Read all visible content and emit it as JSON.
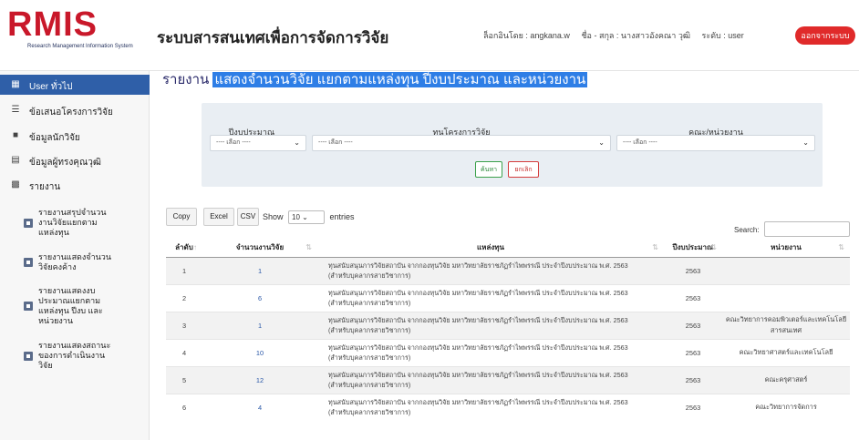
{
  "header": {
    "logo_text": "RMIS",
    "logo_subtitle": "Research Management Information System",
    "app_title": "ระบบสารสนเทศเพื่อการจัดการวิจัย",
    "login_label": "ล็อกอินโดย : angkana.w",
    "name_label": "ชื่อ - สกุล : นางสาวอังคณา วุฒิ",
    "level_label": "ระดับ : user",
    "logout_label": "ออกจากระบบ"
  },
  "sidebar": {
    "items": [
      {
        "label": "User ทั่วไป",
        "icon": "grid-icon"
      },
      {
        "label": "ข้อเสนอโครงการวิจัย",
        "icon": "layers-icon"
      },
      {
        "label": "ข้อมูลนักวิจัย",
        "icon": "folder-icon"
      },
      {
        "label": "ข้อมูลผู้ทรงคุณวุฒิ",
        "icon": "list-icon"
      },
      {
        "label": "รายงาน",
        "icon": "bar-chart-icon"
      }
    ],
    "sub_items": [
      {
        "lines": [
          "รายงานสรุปจำนวน",
          "งานวิจัยแยกตาม",
          "แหล่งทุน"
        ]
      },
      {
        "lines": [
          "รายงานแสดงจำนวน",
          "วิจัยคงค้าง"
        ]
      },
      {
        "lines": [
          "รายงานแสดงงบ",
          "ประมาณแยกตาม",
          "แหล่งทุน ปีงบ และ",
          "หน่วยงาน"
        ]
      },
      {
        "lines": [
          "รายงานแสดงสถานะ",
          "ของการดำเนินงาน",
          "วิจัย"
        ]
      }
    ]
  },
  "main": {
    "heading_prefix": "รายงาน",
    "heading_highlight": "แสดงจำนวนวิจัย แยกตามแหล่งทุน ปีงบประมาณ และหน่วยงาน"
  },
  "filters": {
    "year_label": "ปีงบประมาณ",
    "fund_label": "ทุนโครงการวิจัย",
    "faculty_label": "คณะ/หน่วยงาน",
    "select_placeholder": "---- เลือก ----",
    "search_button": "ค้นหา",
    "cancel_button": "ยกเลิก"
  },
  "table_controls": {
    "copy": "Copy",
    "excel": "Excel",
    "csv": "CSV",
    "show": "Show",
    "entries_value": "10",
    "entries": "entries",
    "search_label": "Search:"
  },
  "table": {
    "headers": [
      "ลำดับ",
      "จำนวนงานวิจัย",
      "แหล่งทุน",
      "ปีงบประมาณ",
      "หน่วยงาน"
    ],
    "rows": [
      {
        "no": "1",
        "count": "1",
        "source_1": "ทุนสนับสนุนการวิจัยสถาบัน จากกองทุนวิจัย มหาวิทยาลัยราชภัฏรำไพพรรณี ประจำปีงบประมาณ พ.ศ. 2563",
        "source_2": "(สำหรับบุคลากรสายวิชาการ)",
        "year": "2563",
        "unit": ""
      },
      {
        "no": "2",
        "count": "6",
        "source_1": "ทุนสนับสนุนการวิจัยสถาบัน จากกองทุนวิจัย มหาวิทยาลัยราชภัฏรำไพพรรณี ประจำปีงบประมาณ พ.ศ. 2563",
        "source_2": "(สำหรับบุคลากรสายวิชาการ)",
        "year": "2563",
        "unit": ""
      },
      {
        "no": "3",
        "count": "1",
        "source_1": "ทุนสนับสนุนการวิจัยสถาบัน จากกองทุนวิจัย มหาวิทยาลัยราชภัฏรำไพพรรณี ประจำปีงบประมาณ พ.ศ. 2563",
        "source_2": "(สำหรับบุคลากรสายวิชาการ)",
        "year": "2563",
        "unit": "คณะวิทยาการคอมพิวเตอร์และเทคโนโลยีสารสนเทศ"
      },
      {
        "no": "4",
        "count": "10",
        "source_1": "ทุนสนับสนุนการวิจัยสถาบัน จากกองทุนวิจัย มหาวิทยาลัยราชภัฏรำไพพรรณี ประจำปีงบประมาณ พ.ศ. 2563",
        "source_2": "(สำหรับบุคลากรสายวิชาการ)",
        "year": "2563",
        "unit": "คณะวิทยาศาสตร์และเทคโนโลยี"
      },
      {
        "no": "5",
        "count": "12",
        "source_1": "ทุนสนับสนุนการวิจัยสถาบัน จากกองทุนวิจัย มหาวิทยาลัยราชภัฏรำไพพรรณี ประจำปีงบประมาณ พ.ศ. 2563",
        "source_2": "(สำหรับบุคลากรสายวิชาการ)",
        "year": "2563",
        "unit": "คณะครุศาสตร์"
      },
      {
        "no": "6",
        "count": "4",
        "source_1": "ทุนสนับสนุนการวิจัยสถาบัน จากกองทุนวิจัย มหาวิทยาลัยราชภัฏรำไพพรรณี ประจำปีงบประมาณ พ.ศ. 2563",
        "source_2": "(สำหรับบุคลากรสายวิชาการ)",
        "year": "2563",
        "unit": "คณะวิทยาการจัดการ"
      }
    ]
  },
  "colors": {
    "accent": "#2f5fa8",
    "logout": "#e02a2a",
    "highlight": "#2e7ee6"
  }
}
